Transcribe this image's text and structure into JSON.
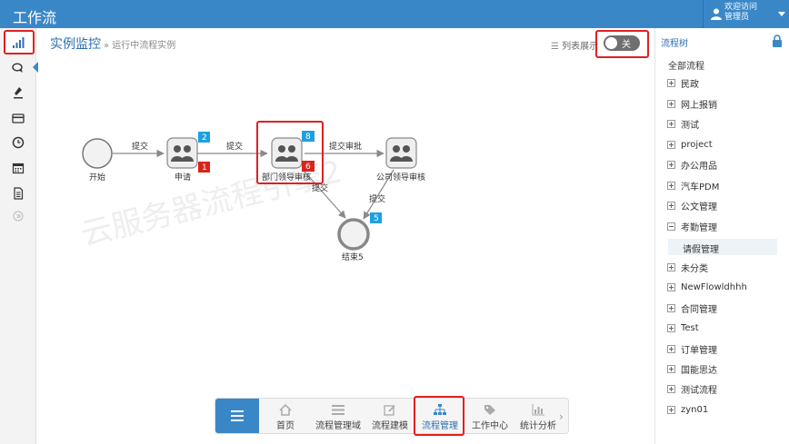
{
  "app": {
    "title": "工作流"
  },
  "user": {
    "greeting": "欢迎访问",
    "name": "管理员"
  },
  "header": {
    "page_title": "实例监控",
    "subtitle": "» 运行中流程实例",
    "list_view_label": "列表展示",
    "toggle_label": "关",
    "toggle_on": false
  },
  "watermark": "云服务器流程引擎2",
  "sidebar": {
    "items": [
      {
        "name": "statistics-icon",
        "active": true
      },
      {
        "name": "chat-icon"
      },
      {
        "name": "pen-icon"
      },
      {
        "name": "card-icon"
      },
      {
        "name": "clock-icon"
      },
      {
        "name": "calendar-icon"
      },
      {
        "name": "document-icon"
      },
      {
        "name": "more-icon"
      }
    ]
  },
  "diagram": {
    "nodes": [
      {
        "id": "start",
        "label": "开始",
        "type": "start"
      },
      {
        "id": "apply",
        "label": "申请",
        "type": "user-task",
        "badge_blue": "2",
        "badge_red": "1"
      },
      {
        "id": "dept",
        "label": "部门领导审核",
        "type": "user-task",
        "badge_blue": "8",
        "badge_red": "6",
        "highlighted": true
      },
      {
        "id": "company",
        "label": "公司领导审核",
        "type": "user-task"
      },
      {
        "id": "end",
        "label": "结束5",
        "type": "end",
        "badge_blue": "5"
      }
    ],
    "edges": [
      {
        "from": "start",
        "to": "apply",
        "label": "提交"
      },
      {
        "from": "apply",
        "to": "dept",
        "label": "提交"
      },
      {
        "from": "dept",
        "to": "company",
        "label": "提交审批"
      },
      {
        "from": "dept",
        "to": "end",
        "label": "提交"
      },
      {
        "from": "company",
        "to": "end",
        "label": "提交"
      }
    ]
  },
  "tree": {
    "title": "流程树",
    "root": "全部流程",
    "items": [
      {
        "label": "民政",
        "expanded": false
      },
      {
        "label": "网上报销",
        "expanded": false
      },
      {
        "label": "测试",
        "expanded": false
      },
      {
        "label": "project",
        "expanded": false
      },
      {
        "label": "办公用品",
        "expanded": false
      },
      {
        "label": "汽车PDM",
        "expanded": false
      },
      {
        "label": "公文管理",
        "expanded": false
      },
      {
        "label": "考勤管理",
        "expanded": true
      },
      {
        "label": "未分类",
        "expanded": false
      },
      {
        "label": "NewFlowldhhh",
        "expanded": false
      },
      {
        "label": "合同管理",
        "expanded": false
      },
      {
        "label": "Test",
        "expanded": false
      },
      {
        "label": "订单管理",
        "expanded": false
      },
      {
        "label": "国能思达",
        "expanded": false
      },
      {
        "label": "测试流程",
        "expanded": false
      },
      {
        "label": "zyn01",
        "expanded": false
      }
    ],
    "selected_child": "请假管理"
  },
  "dock": {
    "items": [
      {
        "label": "首页",
        "icon": "home-icon"
      },
      {
        "label": "流程管理域",
        "icon": "list-icon"
      },
      {
        "label": "流程建模",
        "icon": "edit-icon"
      },
      {
        "label": "流程管理",
        "icon": "org-chart-icon",
        "active": true
      },
      {
        "label": "工作中心",
        "icon": "tag-icon"
      },
      {
        "label": "统计分析",
        "icon": "bar-chart-icon"
      }
    ],
    "more_arrow": "›"
  },
  "colors": {
    "brand": "#3a87c8",
    "highlight": "#e02020",
    "badge_blue": "#1ea0e0",
    "badge_red": "#d9241c"
  }
}
